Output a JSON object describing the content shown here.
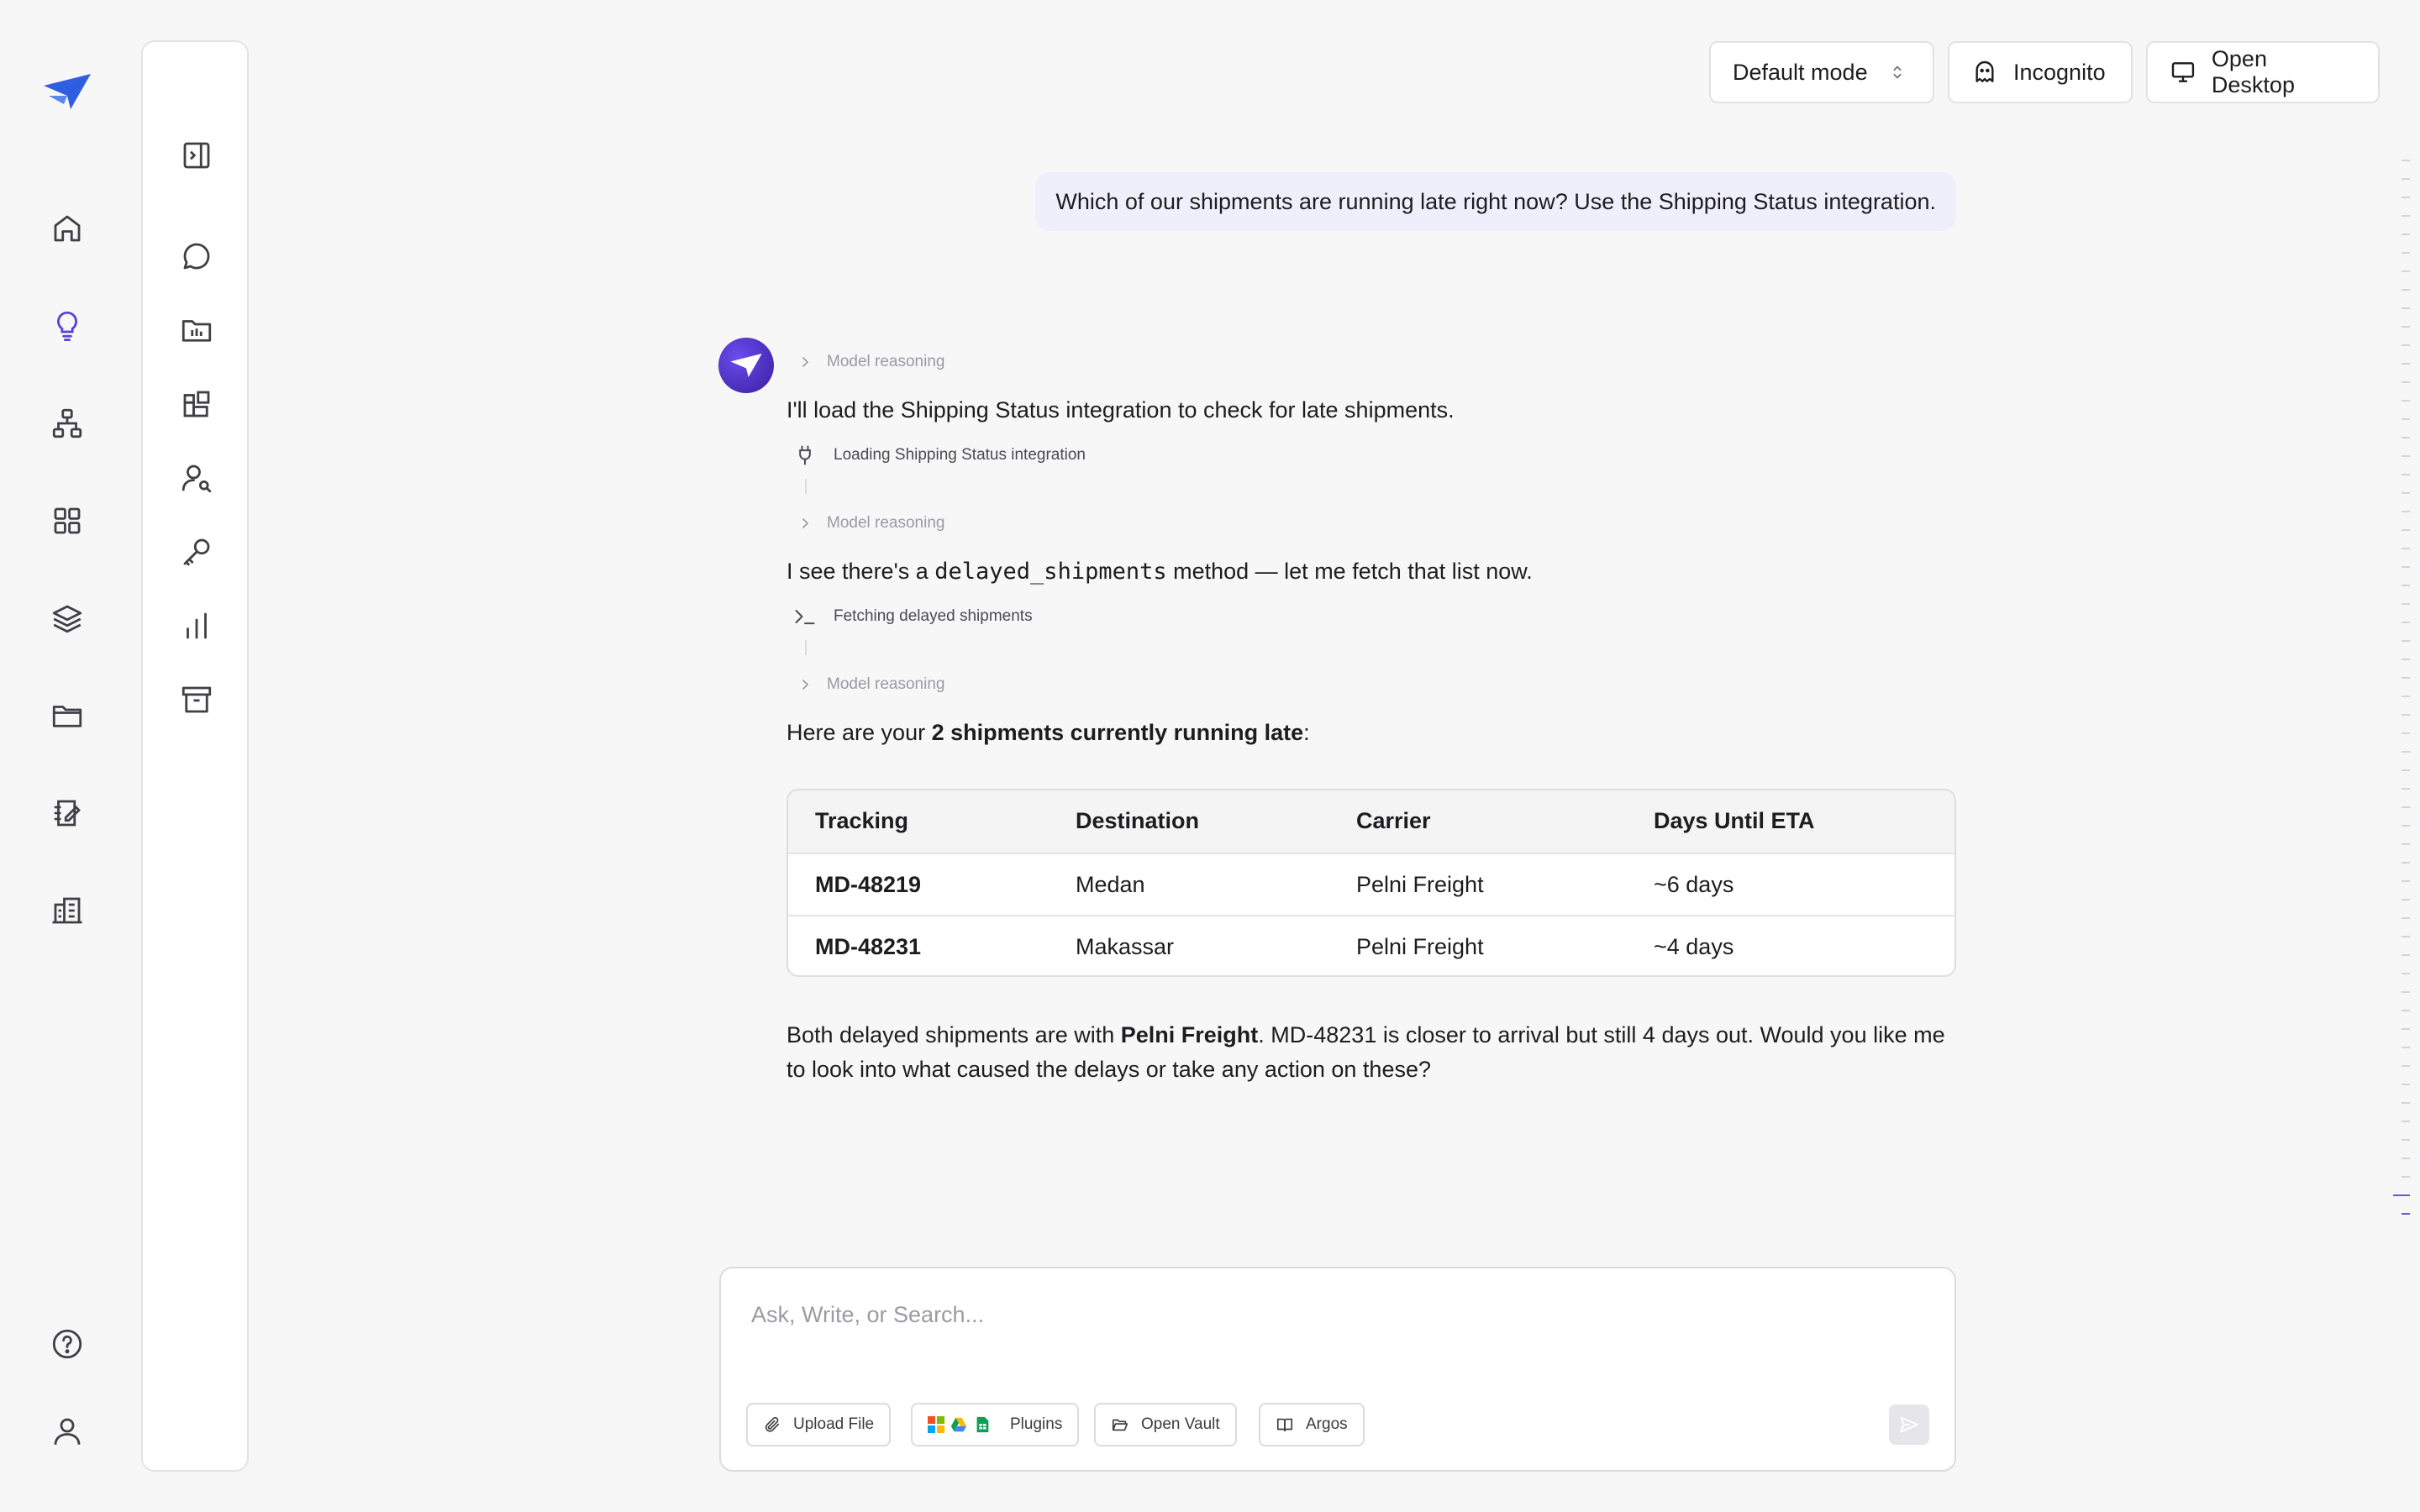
{
  "top": {
    "mode_label": "Default mode",
    "incognito_label": "Incognito",
    "desktop_label": "Open Desktop"
  },
  "rail": {
    "icons": [
      "home-icon",
      "lightbulb-icon",
      "workflow-icon",
      "apps-grid-icon",
      "layers-icon",
      "folder-icon",
      "notebook-icon",
      "building-icon",
      "help-icon",
      "user-icon"
    ]
  },
  "panel": {
    "icons": [
      "sidebar-toggle-icon",
      "chat-bubble-icon",
      "project-folder-icon",
      "widgets-icon",
      "user-search-icon",
      "key-icon",
      "bar-chart-icon",
      "archive-icon"
    ]
  },
  "conversation": {
    "user_message": "Which of our shipments are running late right now? Use the Shipping Status integration.",
    "reasoning_label": "Model reasoning",
    "msg1": "I'll load the Shipping Status integration to check for late shipments.",
    "tool1": "Loading Shipping Status integration",
    "msg2_pre": "I see there's a ",
    "msg2_code": "delayed_shipments",
    "msg2_post": " method — let me fetch that list now.",
    "tool2": "Fetching delayed shipments",
    "msg3_pre": "Here are your ",
    "msg3_bold": "2 shipments currently running late",
    "msg3_post": ":",
    "table": {
      "headers": [
        "Tracking",
        "Destination",
        "Carrier",
        "Days Until ETA"
      ],
      "rows": [
        [
          "MD-48219",
          "Medan",
          "Pelni Freight",
          "~6 days"
        ],
        [
          "MD-48231",
          "Makassar",
          "Pelni Freight",
          "~4 days"
        ]
      ]
    },
    "summary_pre": "Both delayed shipments are with ",
    "summary_bold": "Pelni Freight",
    "summary_post": ". MD-48231 is closer to arrival but still 4 days out. Would you like me to look into what caused the delays or take any action on these?"
  },
  "composer": {
    "placeholder": "Ask, Write, or Search...",
    "upload_label": "Upload File",
    "plugins_label": "Plugins",
    "vault_label": "Open Vault",
    "argos_label": "Argos"
  },
  "colors": {
    "accent": "#5b3fd9",
    "logo_blue": "#2f5fe0",
    "bubble": "#efeefb"
  }
}
